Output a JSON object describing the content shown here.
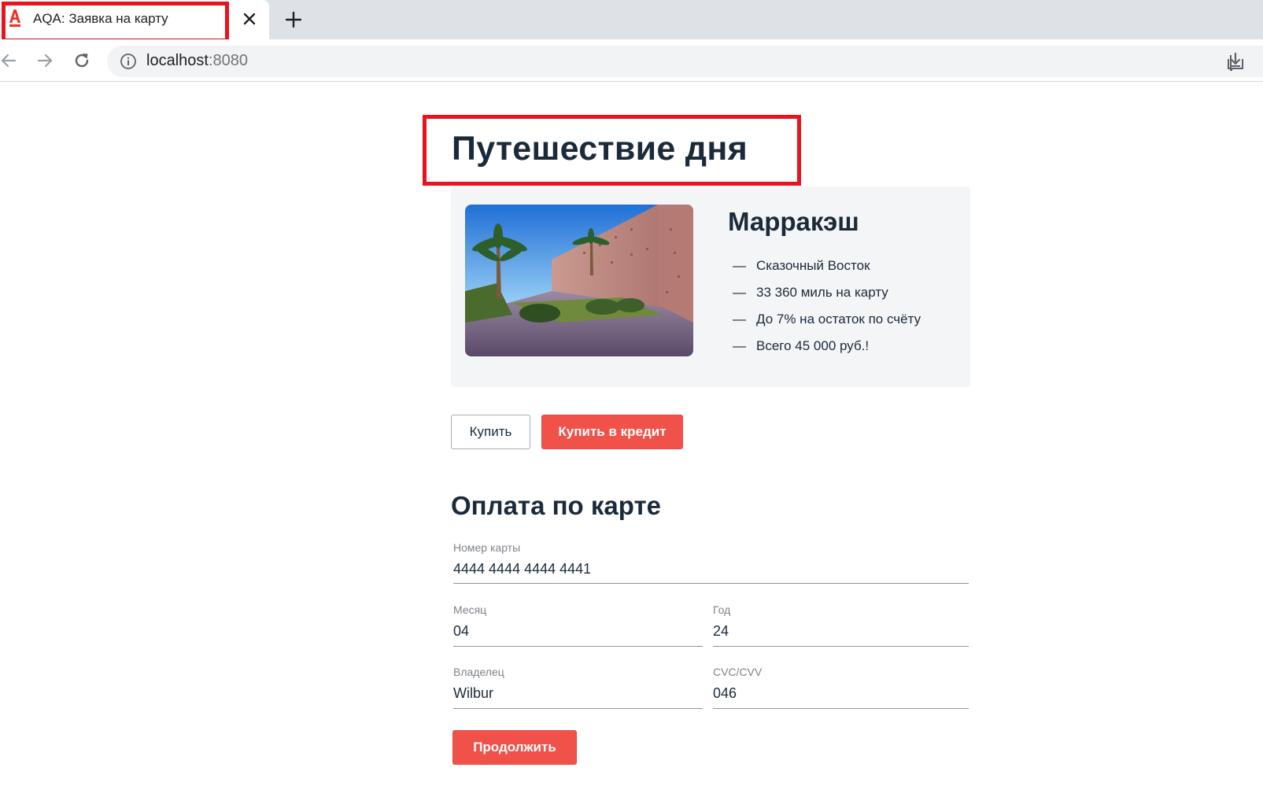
{
  "browser": {
    "tab_title": "AQA: Заявка на карту",
    "url_host": "localhost",
    "url_port": ":8080",
    "colors": {
      "highlight": "#e8131e",
      "favicon": "#ef3124"
    },
    "icons": [
      "alfa-logo-icon",
      "close-icon",
      "plus-icon",
      "back-arrow-icon",
      "forward-arrow-icon",
      "reload-icon",
      "info-icon",
      "install-icon",
      "translate-icon",
      "zoom-out-icon"
    ]
  },
  "page": {
    "title": "Путешествие дня",
    "card": {
      "title": "Марракэш",
      "features": [
        {
          "dash": "—",
          "text": "Сказочный Восток"
        },
        {
          "dash": "—",
          "text": "33 360 миль на карту"
        },
        {
          "dash": "—",
          "text": "До 7% на остаток по счёту"
        },
        {
          "dash": "—",
          "text": "Всего 45 000 руб.!"
        }
      ]
    },
    "buttons": {
      "buy": "Купить",
      "buy_credit": "Купить в кредит",
      "continue": "Продолжить"
    },
    "form": {
      "title": "Оплата по карте",
      "card_number": {
        "label": "Номер карты",
        "value": "4444 4444 4444 4441"
      },
      "month": {
        "label": "Месяц",
        "value": "04"
      },
      "year": {
        "label": "Год",
        "value": "24"
      },
      "owner": {
        "label": "Владелец",
        "value": "Wilbur"
      },
      "cvc": {
        "label": "CVC/CVV",
        "value": "046"
      }
    },
    "colors": {
      "accent": "#f0524a",
      "text": "#1b2a3a",
      "card_bg": "#f4f5f7"
    }
  }
}
